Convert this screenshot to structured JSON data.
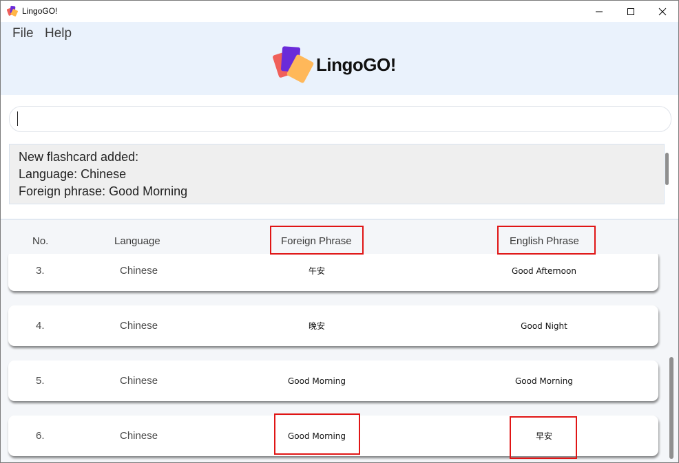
{
  "window": {
    "title": "LingoGO!"
  },
  "menu": {
    "file_label": "File",
    "help_label": "Help"
  },
  "logo": {
    "text": "LingoGO!"
  },
  "command": {
    "value": ""
  },
  "result": {
    "lines": [
      "New flashcard added:",
      "Language: Chinese",
      "Foreign phrase: Good Morning"
    ]
  },
  "table": {
    "headers": {
      "no": "No.",
      "language": "Language",
      "foreign": "Foreign Phrase",
      "english": "English Phrase"
    },
    "rows": [
      {
        "no": "3.",
        "language": "Chinese",
        "foreign": "午安",
        "english": "Good Afternoon"
      },
      {
        "no": "4.",
        "language": "Chinese",
        "foreign": "晚安",
        "english": "Good Night"
      },
      {
        "no": "5.",
        "language": "Chinese",
        "foreign": "Good Morning",
        "english": "Good Morning"
      },
      {
        "no": "6.",
        "language": "Chinese",
        "foreign": "Good Morning",
        "english": "早安"
      }
    ]
  },
  "colors": {
    "header_bg": "#eaf2fc",
    "highlight_box": "#e01515",
    "list_bg": "#f4f6f9"
  }
}
